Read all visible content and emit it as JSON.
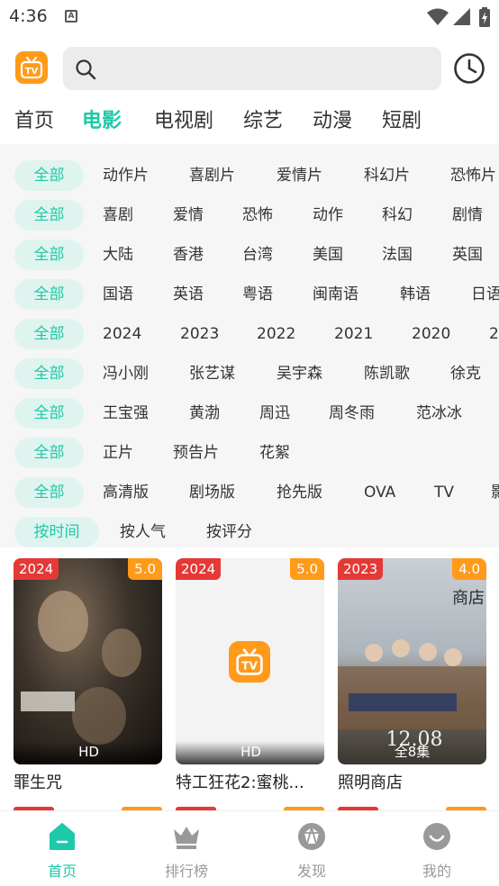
{
  "status_bar": {
    "time": "4:36",
    "notification_glyph": "A"
  },
  "search": {
    "placeholder": ""
  },
  "tabs": [
    "首页",
    "电影",
    "电视剧",
    "综艺",
    "动漫",
    "短剧"
  ],
  "active_tab": "电影",
  "filter_rows": [
    [
      "全部",
      "动作片",
      "喜剧片",
      "爱情片",
      "科幻片",
      "恐怖片"
    ],
    [
      "全部",
      "喜剧",
      "爱情",
      "恐怖",
      "动作",
      "科幻",
      "剧情"
    ],
    [
      "全部",
      "大陆",
      "香港",
      "台湾",
      "美国",
      "法国",
      "英国"
    ],
    [
      "全部",
      "国语",
      "英语",
      "粤语",
      "闽南语",
      "韩语",
      "日语"
    ],
    [
      "全部",
      "2024",
      "2023",
      "2022",
      "2021",
      "2020",
      "2"
    ],
    [
      "全部",
      "冯小刚",
      "张艺谋",
      "吴宇森",
      "陈凯歌",
      "徐克"
    ],
    [
      "全部",
      "王宝强",
      "黄渤",
      "周迅",
      "周冬雨",
      "范冰冰"
    ],
    [
      "全部",
      "正片",
      "预告片",
      "花絮"
    ],
    [
      "全部",
      "高清版",
      "剧场版",
      "抢先版",
      "OVA",
      "TV",
      "影"
    ],
    [
      "按时间",
      "按人气",
      "按评分"
    ]
  ],
  "movies": [
    {
      "year": "2024",
      "score": "5.0",
      "badge": "HD",
      "title": "罪生咒"
    },
    {
      "year": "2024",
      "score": "5.0",
      "badge": "HD",
      "title": "特工狂花2:蜜桃..."
    },
    {
      "year": "2023",
      "score": "4.0",
      "badge": "全8集",
      "title": "照明商店"
    }
  ],
  "bottom_nav": [
    {
      "label": "首页",
      "icon": "home-icon",
      "active": true
    },
    {
      "label": "排行榜",
      "icon": "crown-icon",
      "active": false
    },
    {
      "label": "发现",
      "icon": "aperture-icon",
      "active": false
    },
    {
      "label": "我的",
      "icon": "smile-icon",
      "active": false
    }
  ],
  "colors": {
    "accent": "#1dc9a8",
    "brand": "#ff9a1a",
    "year_tag": "#e53935",
    "inactive": "#999999"
  }
}
